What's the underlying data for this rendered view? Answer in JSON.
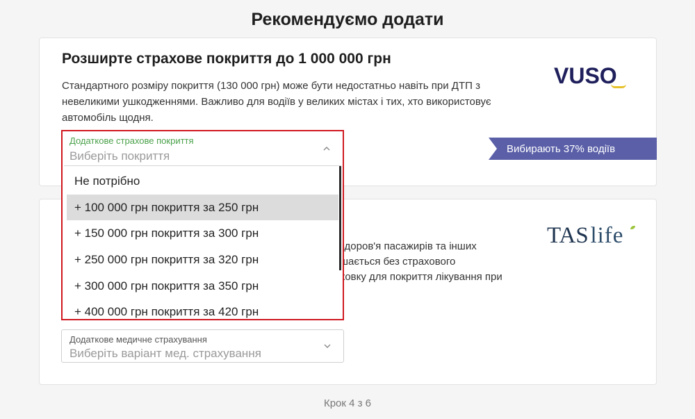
{
  "page_title": "Рекомендуємо додати",
  "card1": {
    "title": "Розширте страхове покриття до 1 000 000 грн",
    "desc": "Стандартного розміру покриття (130 000 грн) може бути недостатньо навіть при ДТП з невеликими ушкодженнями. Важливо для водіїв у великих містах і тих, хто використовує автомобіль щодня.",
    "logo": "VUSO",
    "ribbon": "Вибирають 37% водіїв",
    "select": {
      "label": "Додаткове страхове покриття",
      "placeholder": "Виберіть покриття",
      "options": [
        "Не потрібно",
        "+ 100 000 грн покриття за 250 грн",
        "+ 150 000 грн покриття за 300 грн",
        "+ 250 000 грн покриття за 320 грн",
        "+ 300 000 грн покриття за 350 грн",
        "+ 400 000 грн покриття за 420 грн"
      ],
      "highlighted_index": 1
    }
  },
  "card2": {
    "logo_main": "TAS",
    "logo_sub": "life",
    "desc_visible": "здоров'я пасажирів та інших\nшається без страхового\nховку для покриття лікування при",
    "select": {
      "label": "Додаткове медичне страхування",
      "placeholder": "Виберіть варіант мед. страхування"
    }
  },
  "step": "Крок 4 з 6",
  "colors": {
    "accent_red": "#d0171f",
    "label_green": "#4aa14a",
    "ribbon": "#5a5fa8"
  }
}
